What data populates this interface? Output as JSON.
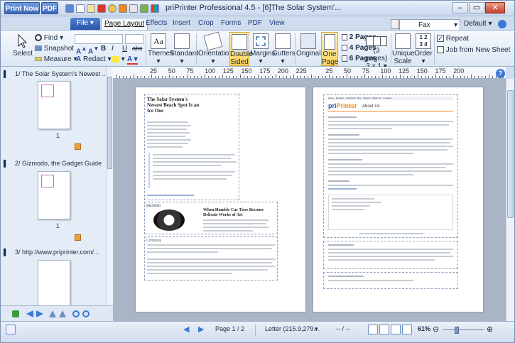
{
  "title_bar": {
    "print_now": "Print Now",
    "pdf": "PDF",
    "title": "priPrinter Professional 4.5 - [6]The Solar System'...",
    "printer": "Fax",
    "profile": "Default"
  },
  "tabs": [
    "File",
    "Page Layout",
    "Effects",
    "Insert",
    "Crop",
    "Forms",
    "PDF",
    "View"
  ],
  "ribbon": {
    "select": "Select",
    "find": "Find",
    "snapshot": "Snapshot",
    "measure": "Measure",
    "redact": "Redact",
    "font_bold": "B",
    "font_italic": "I",
    "font_underline": "U",
    "font_strike": "abc",
    "themes": "Themes",
    "standard": "Standard",
    "orientation": "Orientation",
    "double_sided": "Double Sided",
    "margins": "Margins",
    "gutters": "Gutters",
    "original": "Original",
    "one_page": "One Page",
    "two_pages": "2 Pages",
    "four_pages": "4 Pages",
    "six_pages": "6 Pages",
    "pages_count": "(3 pages)",
    "pages_grid": "3 x 1",
    "unique_scale": "Unique Scale",
    "order": "Order",
    "repeat": "Repeat",
    "job_from_new_sheet": "Job from New Sheet"
  },
  "ruler": {
    "labels": [
      "25",
      "50",
      "75",
      "100",
      "125",
      "150",
      "175",
      "200",
      "225",
      "25",
      "50",
      "75",
      "100",
      "125",
      "150",
      "175",
      "200"
    ]
  },
  "thumbnails": [
    {
      "title": "1/ The Solar System's Newest ...",
      "page": "1"
    },
    {
      "title": "2/ Gizmodo, the Gadget Guide",
      "page": "1"
    },
    {
      "title": "3/ http://www.priprinter.com/..."
    }
  ],
  "page_left": {
    "heading": "The Solar System's Newest Beach Spot Is an Ice One",
    "section2_title": "When Humble Car Tires Become Delicate Works of Art",
    "small_label": "Gizmodo",
    "company_label": "Company"
  },
  "page_right": {
    "logo_main": "pri",
    "logo_accent": "Printer",
    "about": "About Us",
    "nav": [
      "Home",
      "Features",
      "Download",
      "Buy",
      "Support",
      "About Us",
      "Contacts"
    ]
  },
  "status": {
    "page": "Page 1 / 2",
    "paper": "Letter (215.9,279....",
    "position": "-- / --",
    "zoom": "61%"
  },
  "colors": {
    "accent": "#2c55a8",
    "highlight": "#ffd45a",
    "logo_orange": "#f08a1c"
  }
}
